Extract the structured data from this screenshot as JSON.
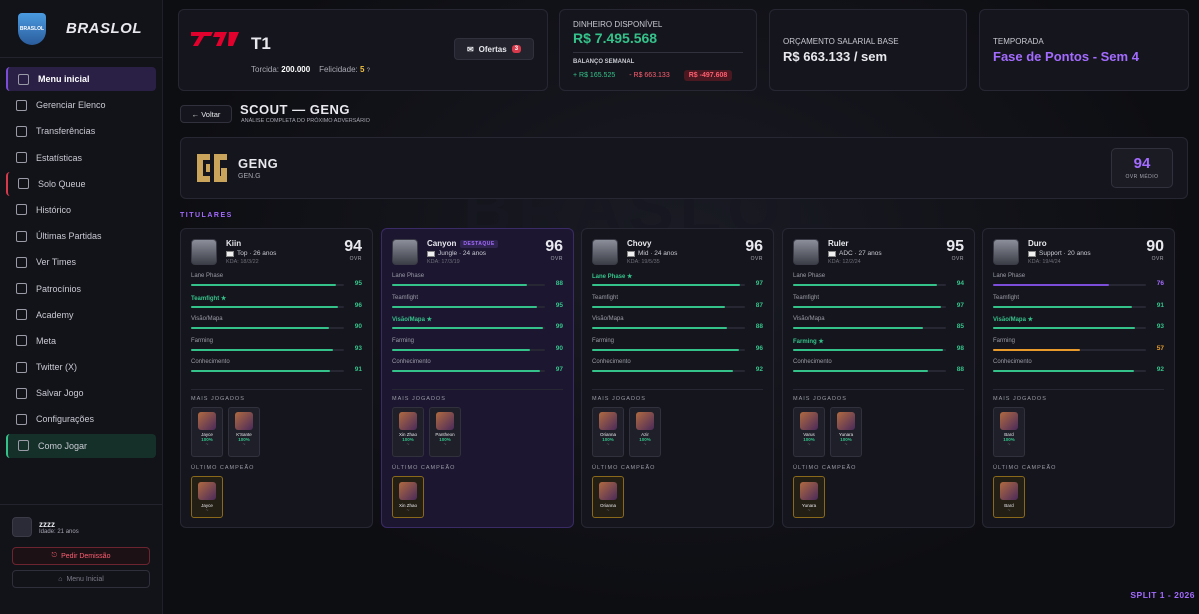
{
  "brand": {
    "badge": "BRASLOL",
    "name": "BRASLOL"
  },
  "nav": [
    {
      "label": "Menu inicial",
      "icon": "home-icon",
      "name": "home"
    },
    {
      "label": "Gerenciar Elenco",
      "icon": "users-icon",
      "name": "roster"
    },
    {
      "label": "Transferências",
      "icon": "transfer-icon",
      "name": "transfers"
    },
    {
      "label": "Estatísticas",
      "icon": "chart-icon",
      "name": "stats"
    },
    {
      "label": "Solo Queue",
      "icon": "controller-icon",
      "name": "solo-queue"
    },
    {
      "label": "Histórico",
      "icon": "clock-icon",
      "name": "history"
    },
    {
      "label": "Últimas Partidas",
      "icon": "list-icon",
      "name": "last-matches"
    },
    {
      "label": "Ver Times",
      "icon": "team-icon",
      "name": "teams"
    },
    {
      "label": "Patrocínios",
      "icon": "sponsor-icon",
      "name": "sponsors"
    },
    {
      "label": "Academy",
      "icon": "academy-icon",
      "name": "academy"
    },
    {
      "label": "Meta",
      "icon": "compass-icon",
      "name": "meta"
    },
    {
      "label": "Twitter (X)",
      "icon": "twitter-icon",
      "name": "twitter"
    },
    {
      "label": "Salvar Jogo",
      "icon": "save-icon",
      "name": "save"
    },
    {
      "label": "Configurações",
      "icon": "gear-icon",
      "name": "settings"
    },
    {
      "label": "Como Jogar",
      "icon": "help-icon",
      "name": "how-to-play"
    }
  ],
  "user": {
    "name": "zzzz",
    "age": "Idade: 21 anos",
    "demission": "Pedir Demissão",
    "menu": "Menu Inicial"
  },
  "team": {
    "name": "T1",
    "fans_label": "Torcida:",
    "fans": "200.000",
    "happy_label": "Felicidade:",
    "happy": "5",
    "happy_q": "?",
    "offers": "Ofertas",
    "offers_count": "3"
  },
  "finance": {
    "cash_label": "DINHEIRO DISPONÍVEL",
    "cash": "R$ 7.495.568",
    "weekly_label": "BALANÇO SEMANAL",
    "income": "+ R$ 165.525",
    "expense": "- R$ 663.133",
    "net": "R$ -497.608"
  },
  "salary": {
    "label": "ORÇAMENTO SALARIAL BASE",
    "value": "R$ 663.133 / sem"
  },
  "season": {
    "label": "TEMPORADA",
    "value": "Fase de Pontos - Sem 4"
  },
  "scout": {
    "back": "← Voltar",
    "title": "SCOUT — GENG",
    "subtitle": "ANÁLISE COMPLETA DO PRÓXIMO ADVERSÁRIO"
  },
  "opponent": {
    "name": "GENG",
    "tag": "GEN.G",
    "ovr": "94",
    "ovr_label": "OVR MÉDIO"
  },
  "starters_label": "TITULARES",
  "labels": {
    "ovr": "OVR",
    "most_played": "MAIS JOGADOS",
    "last_champ": "ÚLTIMO CAMPEÃO",
    "featured": "DESTAQUE",
    "tilde": "~"
  },
  "players": [
    {
      "name": "Kiin",
      "role": "Top · 26 anos",
      "kda": "KDA: 18/3/22",
      "ovr": "94",
      "stats": [
        {
          "n": "Lane Phase",
          "v": 95,
          "best": false,
          "c": "#35c28a"
        },
        {
          "n": "Teamfight ★",
          "v": 96,
          "best": true,
          "c": "#35c28a"
        },
        {
          "n": "Visão/Mapa",
          "v": 90,
          "best": false,
          "c": "#35c28a"
        },
        {
          "n": "Farming",
          "v": 93,
          "best": false,
          "c": "#35c28a"
        },
        {
          "n": "Conhecimento",
          "v": 91,
          "best": false,
          "c": "#35c28a"
        }
      ],
      "champs": [
        {
          "n": "Jayce",
          "p": "100%"
        },
        {
          "n": "K&#x27;Sante",
          "p": "100%"
        }
      ],
      "last": "Jayce"
    },
    {
      "name": "Canyon",
      "role": "Jungle · 24 anos",
      "kda": "KDA: 17/3/19",
      "ovr": "96",
      "featured": true,
      "stats": [
        {
          "n": "Lane Phase",
          "v": 88,
          "best": false,
          "c": "#35c28a"
        },
        {
          "n": "Teamfight",
          "v": 95,
          "best": false,
          "c": "#35c28a"
        },
        {
          "n": "Visão/Mapa ★",
          "v": 99,
          "best": true,
          "c": "#35c28a"
        },
        {
          "n": "Farming",
          "v": 90,
          "best": false,
          "c": "#35c28a"
        },
        {
          "n": "Conhecimento",
          "v": 97,
          "best": false,
          "c": "#35c28a"
        }
      ],
      "champs": [
        {
          "n": "Xin Zhao",
          "p": "100%"
        },
        {
          "n": "Pantheon",
          "p": "100%"
        }
      ],
      "last": "Xin Zhao"
    },
    {
      "name": "Chovy",
      "role": "Mid · 24 anos",
      "kda": "KDA: 19/5/35",
      "ovr": "96",
      "stats": [
        {
          "n": "Lane Phase ★",
          "v": 97,
          "best": true,
          "c": "#35c28a"
        },
        {
          "n": "Teamfight",
          "v": 87,
          "best": false,
          "c": "#35c28a"
        },
        {
          "n": "Visão/Mapa",
          "v": 88,
          "best": false,
          "c": "#35c28a"
        },
        {
          "n": "Farming",
          "v": 96,
          "best": false,
          "c": "#35c28a"
        },
        {
          "n": "Conhecimento",
          "v": 92,
          "best": false,
          "c": "#35c28a"
        }
      ],
      "champs": [
        {
          "n": "Orianna",
          "p": "100%"
        },
        {
          "n": "Azir",
          "p": "100%"
        }
      ],
      "last": "Orianna"
    },
    {
      "name": "Ruler",
      "role": "ADC · 27 anos",
      "kda": "KDA: 12/2/24",
      "ovr": "95",
      "stats": [
        {
          "n": "Lane Phase",
          "v": 94,
          "best": false,
          "c": "#35c28a"
        },
        {
          "n": "Teamfight",
          "v": 97,
          "best": false,
          "c": "#35c28a"
        },
        {
          "n": "Visão/Mapa",
          "v": 85,
          "best": false,
          "c": "#35c28a"
        },
        {
          "n": "Farming ★",
          "v": 98,
          "best": true,
          "c": "#35c28a"
        },
        {
          "n": "Conhecimento",
          "v": 88,
          "best": false,
          "c": "#35c28a"
        }
      ],
      "champs": [
        {
          "n": "Varus",
          "p": "100%"
        },
        {
          "n": "Yunara",
          "p": "100%"
        }
      ],
      "last": "Yunara"
    },
    {
      "name": "Duro",
      "role": "Support · 20 anos",
      "kda": "KDA: 19/4/24",
      "ovr": "90",
      "stats": [
        {
          "n": "Lane Phase",
          "v": 76,
          "best": false,
          "c": "#7c4dd8"
        },
        {
          "n": "Teamfight",
          "v": 91,
          "best": false,
          "c": "#35c28a"
        },
        {
          "n": "Visão/Mapa ★",
          "v": 93,
          "best": true,
          "c": "#35c28a"
        },
        {
          "n": "Farming",
          "v": 57,
          "best": false,
          "c": "#e89b2a"
        },
        {
          "n": "Conhecimento",
          "v": 92,
          "best": false,
          "c": "#35c28a"
        }
      ],
      "champs": [
        {
          "n": "Bard",
          "p": "100%"
        }
      ],
      "last": "Bard"
    }
  ],
  "split": "SPLIT 1 - 2026",
  "watermark": "BRASLOL"
}
